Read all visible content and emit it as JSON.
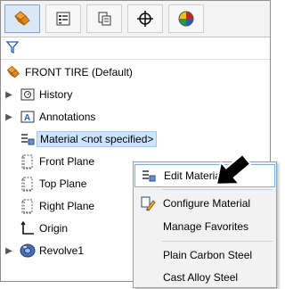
{
  "toolbar": {
    "tabs": [
      {
        "name": "feature-manager",
        "icon": "feature-manager-icon"
      },
      {
        "name": "property-manager",
        "icon": "property-manager-icon"
      },
      {
        "name": "configuration-manager",
        "icon": "configuration-manager-icon"
      },
      {
        "name": "dimxpert-manager",
        "icon": "crosshair-icon"
      },
      {
        "name": "display-manager",
        "icon": "appearance-sphere-icon"
      }
    ]
  },
  "filter": {
    "icon": "funnel-icon"
  },
  "tree": {
    "root": {
      "label": "FRONT TIRE  (Default)"
    },
    "items": [
      {
        "label": "History",
        "expandable": true
      },
      {
        "label": "Annotations",
        "expandable": true
      },
      {
        "label": "Material <not specified>",
        "expandable": false,
        "selected": true
      },
      {
        "label": "Front Plane"
      },
      {
        "label": "Top Plane"
      },
      {
        "label": "Right Plane"
      },
      {
        "label": "Origin"
      },
      {
        "label": "Revolve1",
        "expandable": true
      }
    ]
  },
  "context_menu": {
    "items": [
      {
        "label": "Edit Material",
        "icon": "edit-material-icon",
        "hover": true
      },
      {
        "label": "Configure Material",
        "icon": "configure-material-icon"
      },
      {
        "label": "Manage Favorites"
      },
      {
        "label": "Plain Carbon Steel"
      },
      {
        "label": "Cast Alloy Steel"
      }
    ]
  },
  "colors": {
    "accent": "#cce4ff",
    "active_tab": "#d9e7f7",
    "menu_bg": "#f2f2f2"
  }
}
